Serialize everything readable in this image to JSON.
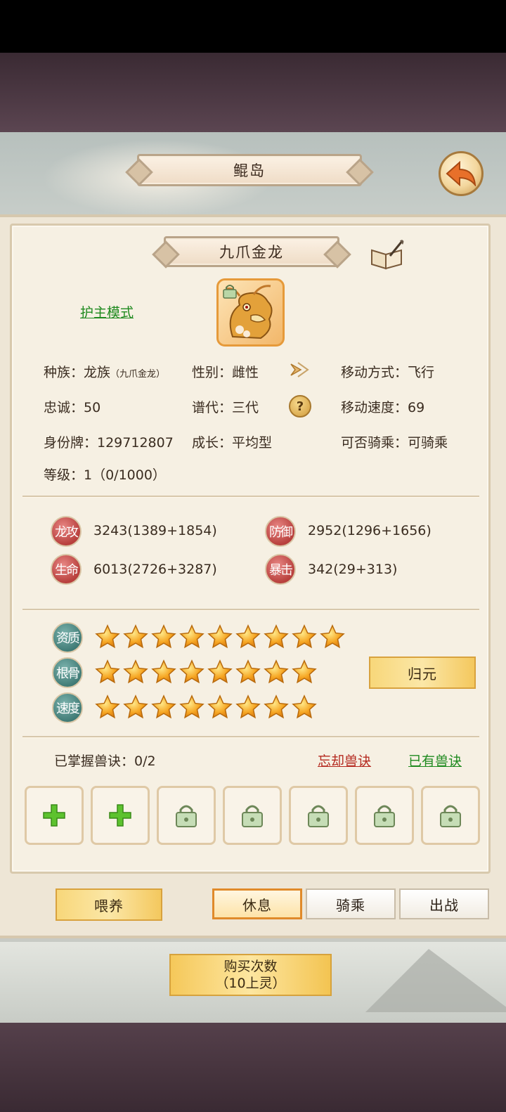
{
  "header": {
    "title": "鲲岛"
  },
  "pet": {
    "name": "九爪金龙",
    "mode_link": "护主模式",
    "race_label": "种族：",
    "race_value": "龙族",
    "race_sub": "（九爪金龙）",
    "gender": "性别：雌性",
    "move_type": "移动方式：飞行",
    "loyalty": "忠诚：50",
    "generation": "谱代：三代",
    "move_speed": "移动速度：69",
    "id_tag": "身份牌：129712807",
    "growth": "成长：平均型",
    "rideable": "可否骑乘：可骑乘",
    "level": "等级：1（0/1000）"
  },
  "attributes": {
    "attack_label": "龙攻",
    "attack_value": "3243(1389+1854)",
    "defense_label": "防御",
    "defense_value": "2952(1296+1656)",
    "hp_label": "生命",
    "hp_value": "6013(2726+3287)",
    "crit_label": "暴击",
    "crit_value": "342(29+313)"
  },
  "talents": {
    "aptitude_label": "资质",
    "aptitude_stars": 9,
    "bone_label": "根骨",
    "bone_stars": 8,
    "speed_label": "速度",
    "speed_stars": 8,
    "reset_button": "归元"
  },
  "skills": {
    "mastered": "已掌握兽诀：0/2",
    "forget_link": "忘却兽诀",
    "owned_link": "已有兽诀"
  },
  "actions": {
    "feed": "喂养",
    "rest": "休息",
    "ride": "骑乘",
    "battle": "出战"
  },
  "purchase": {
    "line1": "购买次数",
    "line2": "（10上灵）"
  },
  "colors": {
    "gold": "#f8d77a",
    "green_link": "#1f8a1f",
    "red_link": "#b52a20"
  }
}
